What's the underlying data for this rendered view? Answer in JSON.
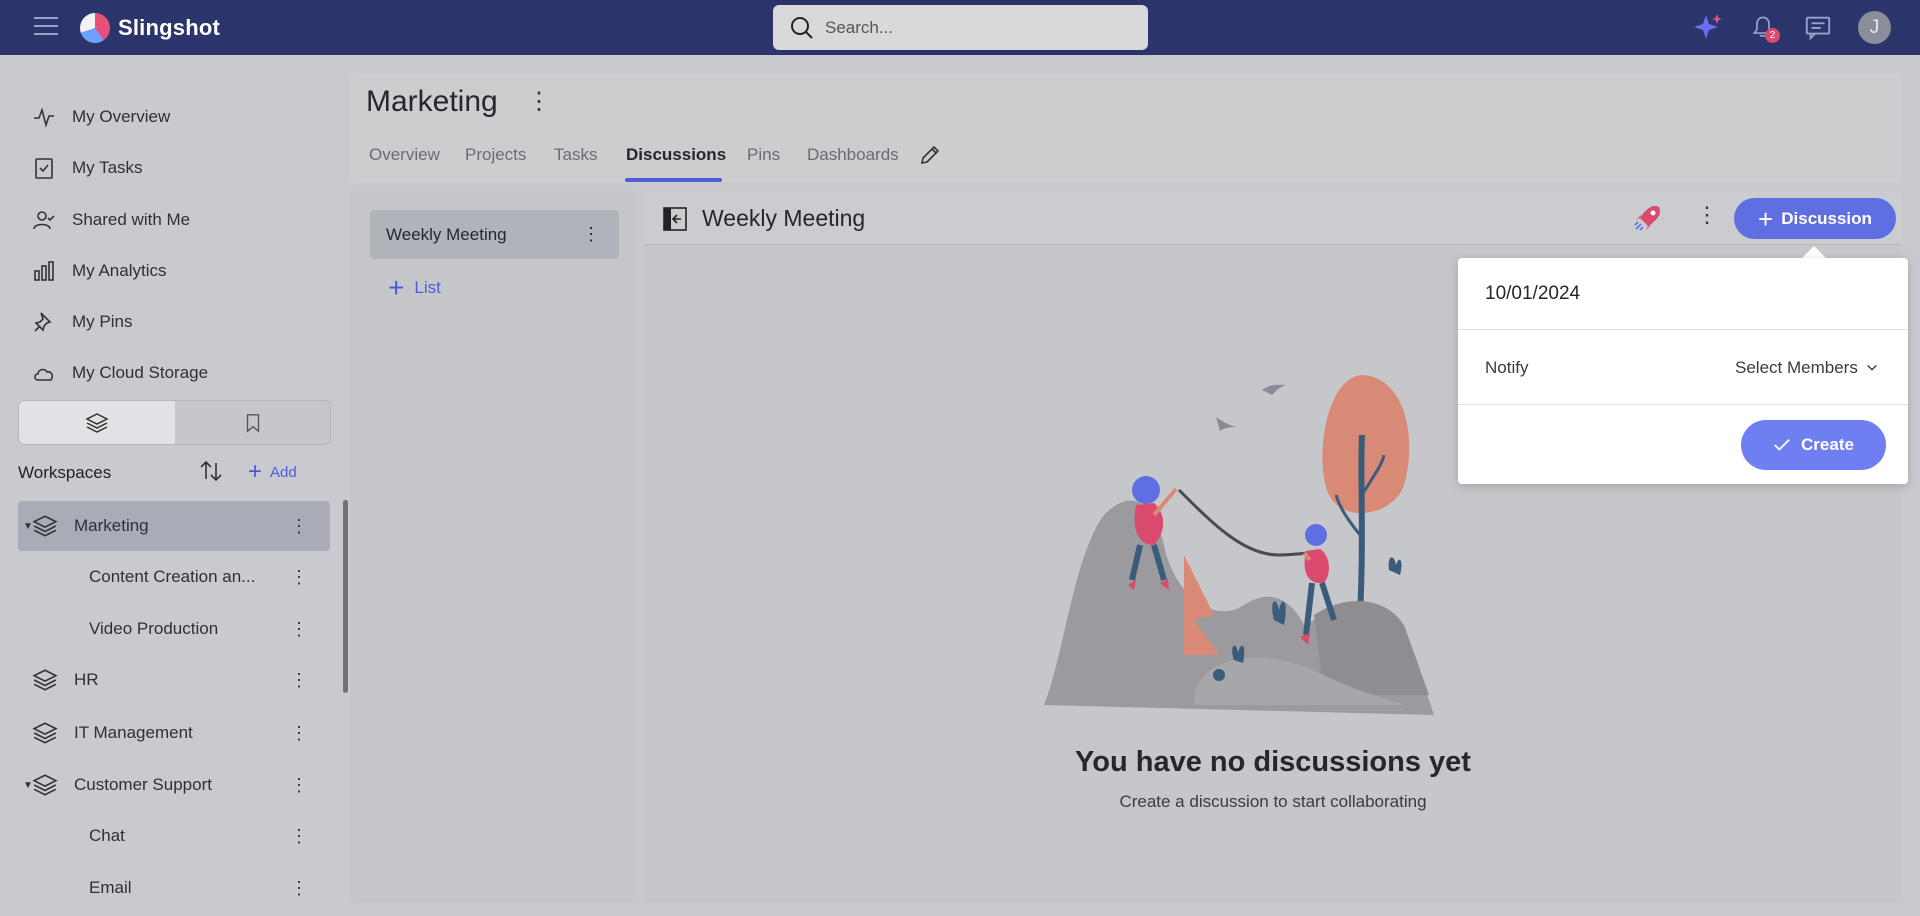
{
  "app": {
    "name": "Slingshot",
    "search_placeholder": "Search...",
    "notification_count": "2",
    "user_initial": "J"
  },
  "sidebar": {
    "nav": [
      {
        "label": "My Overview",
        "icon": "pulse-icon"
      },
      {
        "label": "My Tasks",
        "icon": "task-check-icon"
      },
      {
        "label": "Shared with Me",
        "icon": "user-check-icon"
      },
      {
        "label": "My Analytics",
        "icon": "bar-chart-icon"
      },
      {
        "label": "My Pins",
        "icon": "pin-icon"
      },
      {
        "label": "My Cloud Storage",
        "icon": "cloud-icon"
      }
    ],
    "workspaces_title": "Workspaces",
    "add_label": "Add",
    "tree": [
      {
        "label": "Marketing",
        "level": 0,
        "expanded": true,
        "active": true
      },
      {
        "label": "Content Creation an...",
        "level": 1
      },
      {
        "label": "Video Production",
        "level": 1
      },
      {
        "label": "HR",
        "level": 0
      },
      {
        "label": "IT Management",
        "level": 0
      },
      {
        "label": "Customer Support",
        "level": 0,
        "expanded": true
      },
      {
        "label": "Chat",
        "level": 1
      },
      {
        "label": "Email",
        "level": 1
      }
    ]
  },
  "project": {
    "title": "Marketing",
    "tabs": [
      "Overview",
      "Projects",
      "Tasks",
      "Discussions",
      "Pins",
      "Dashboards"
    ],
    "active_tab": "Discussions"
  },
  "lists": {
    "items": [
      "Weekly Meeting"
    ],
    "add_label": "List"
  },
  "main": {
    "title": "Weekly Meeting",
    "discussion_button": "Discussion",
    "empty_title": "You have no discussions yet",
    "empty_subtitle": "Create a discussion to start collaborating"
  },
  "popup": {
    "date": "10/01/2024",
    "notify_label": "Notify",
    "select_members": "Select Members",
    "create_label": "Create"
  },
  "colors": {
    "topbar": "#2b356b",
    "accent": "#4e5bd6",
    "button": "#5f6ee0"
  }
}
